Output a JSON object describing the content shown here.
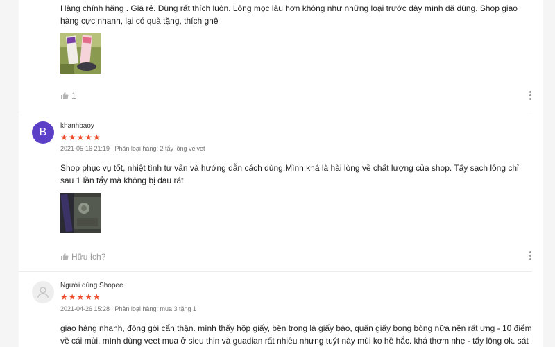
{
  "reviews": [
    {
      "text": "Hàng chính hãng . Giá rẻ. Dùng rất thích luôn. Lông mọc lâu hơn không như những loại trước đây mình đã dùng. Shop giao hàng cực nhanh, lại có quà tặng, thích ghê",
      "like_label": "1"
    },
    {
      "avatar_letter": "B",
      "author": "khanhbaoy",
      "stars": "★★★★★",
      "meta": "2021-05-16 21:19 | Phân loại hàng: 2 tẩy lông velvet",
      "text": "Shop phục vụ tốt, nhiệt tình tư vấn và hướng dẫn cách dùng.Mình khá là hài lòng về chất lượng của shop. Tẩy sạch lông chỉ sau 1 lần tẩy mà không bị đau rát",
      "like_label": "Hữu Ích?"
    },
    {
      "author": "Người dùng Shopee",
      "stars": "★★★★★",
      "meta": "2021-04-26 15:28 | Phân loại hàng: mua 3 tặng 1",
      "text": "giao hàng nhanh, đóng gói cẩn thận. mình thấy hộp giấy, bên trong là giấy báo, quấn giấy bong bóng nữa nên rất ưng - 10 điểm về cái mùi. mình dùng veet mua ở sieu thin và guadian rất nhiều nhưng tuýt này mùi ko hề hắc. khá thơm nhẹ - tẩy lông ok. sát hay ko"
    }
  ],
  "colors": {
    "star": "#ee4d2d",
    "avatar_purple": "#5b3fc6",
    "muted": "#9a9a9a"
  },
  "icons": {
    "like": "thumbs-up-icon",
    "more": "more-vertical-icon",
    "default_avatar": "user-icon"
  }
}
